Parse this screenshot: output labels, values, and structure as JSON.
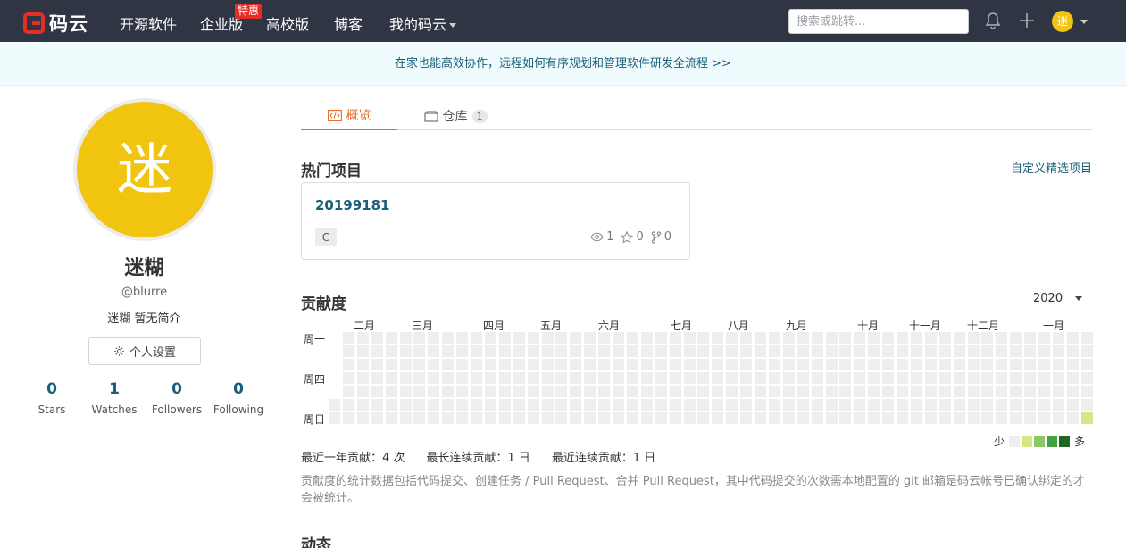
{
  "nav": {
    "logo_text": "码云",
    "links": [
      "开源软件",
      "企业版",
      "高校版",
      "博客",
      "我的码云"
    ],
    "badge": "特惠",
    "search_placeholder": "搜索或跳转...",
    "avatar_char": "迷"
  },
  "banner": {
    "text": "在家也能高效协作，远程如何有序规划和管理软件研发全流程 >>"
  },
  "profile": {
    "avatar_char": "迷",
    "name": "迷糊",
    "handle": "@blurre",
    "bio": "迷糊 暂无简介",
    "settings_label": "个人设置",
    "stats": [
      {
        "value": "0",
        "label": "Stars"
      },
      {
        "value": "1",
        "label": "Watches"
      },
      {
        "value": "0",
        "label": "Followers"
      },
      {
        "value": "0",
        "label": "Following"
      }
    ]
  },
  "tabs": [
    {
      "label": "概览",
      "count": ""
    },
    {
      "label": "仓库",
      "count": "1"
    }
  ],
  "hot_projects": {
    "title": "热门项目",
    "customize_label": "自定义精选项目",
    "project": {
      "name": "20199181",
      "language": "C",
      "watchers": "1",
      "stars": "0",
      "forks": "0"
    }
  },
  "contribution": {
    "title": "贡献度",
    "year": "2020",
    "months": [
      "二月",
      "三月",
      "四月",
      "五月",
      "六月",
      "七月",
      "八月",
      "九月",
      "十月",
      "十一月",
      "十二月",
      "一月"
    ],
    "day_labels": [
      "周一",
      "周四",
      "周日"
    ],
    "legend_less": "少",
    "legend_more": "多",
    "colors": [
      "#eeeeee",
      "#d6e685",
      "#8cc665",
      "#44a340",
      "#1e6823"
    ],
    "active_cells": [
      {
        "week": 53,
        "day": 6,
        "level": 1
      }
    ],
    "stats": {
      "last_year": "最近一年贡献：4 次",
      "longest": "最长连续贡献：1 日",
      "recent": "最近连续贡献：1 日"
    },
    "note": "贡献度的统计数据包括代码提交、创建任务 / Pull Request、合并 Pull Request，其中代码提交的次数需本地配置的 git 邮箱是码云帐号已确认绑定的才会被统计。"
  },
  "activity": {
    "title": "动态"
  }
}
